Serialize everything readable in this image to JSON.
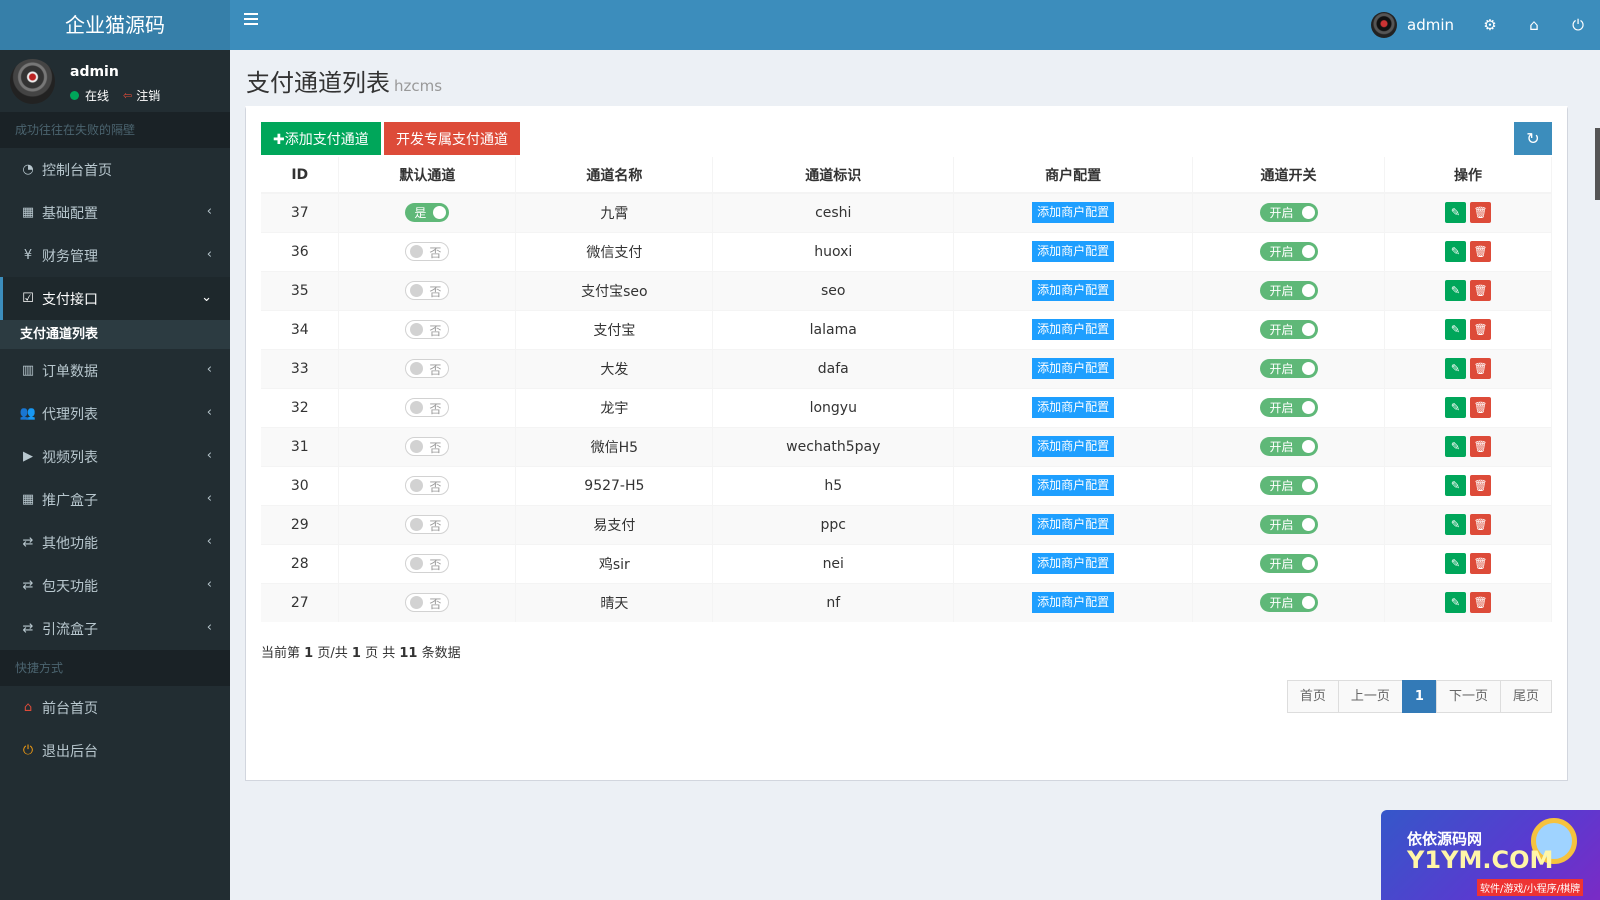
{
  "brand": {
    "title": "企业猫源码"
  },
  "header": {
    "username": "admin"
  },
  "sidebar": {
    "user": {
      "name": "admin",
      "online": "在线",
      "logout": "注销"
    },
    "motto": "成功往往在失败的隔壁",
    "items": [
      {
        "label": "控制台首页",
        "icon": "dashboard-icon",
        "glyph": "◔"
      },
      {
        "label": "基础配置",
        "icon": "grid-icon",
        "glyph": "▦"
      },
      {
        "label": "财务管理",
        "icon": "yen-icon",
        "glyph": "¥"
      },
      {
        "label": "支付接口",
        "icon": "checkbox-icon",
        "glyph": "☑"
      },
      {
        "label": "订单数据",
        "icon": "bar-chart-icon",
        "glyph": "▥"
      },
      {
        "label": "代理列表",
        "icon": "users-icon",
        "glyph": "👥"
      },
      {
        "label": "视频列表",
        "icon": "video-icon",
        "glyph": "▶"
      },
      {
        "label": "推广盒子",
        "icon": "table-icon",
        "glyph": "▦"
      },
      {
        "label": "其他功能",
        "icon": "retweet-icon",
        "glyph": "⇄"
      },
      {
        "label": "包天功能",
        "icon": "retweet-icon",
        "glyph": "⇄"
      },
      {
        "label": "引流盒子",
        "icon": "retweet-icon",
        "glyph": "⇄"
      }
    ],
    "active_sub": "支付通道列表",
    "shortcuts_header": "快捷方式",
    "shortcuts": [
      {
        "label": "前台首页",
        "icon": "home-icon",
        "glyph": "⌂",
        "color": "#dd4b39"
      },
      {
        "label": "退出后台",
        "icon": "power-icon",
        "glyph": "⏻",
        "color": "#f39c12"
      }
    ]
  },
  "page": {
    "title": "支付通道列表",
    "subtitle": "hzcms"
  },
  "toolbar": {
    "add_label": "✚添加支付通道",
    "dev_label": "开发专属支付通道"
  },
  "table": {
    "columns": [
      "ID",
      "默认通道",
      "通道名称",
      "通道标识",
      "商户配置",
      "通道开关",
      "操作"
    ],
    "default_yes": "是",
    "default_no": "否",
    "merchant_btn": "添加商户配置",
    "switch_on": "开启",
    "rows": [
      {
        "id": "37",
        "default": true,
        "name": "九霄",
        "code": "ceshi"
      },
      {
        "id": "36",
        "default": false,
        "name": "微信支付",
        "code": "huoxi"
      },
      {
        "id": "35",
        "default": false,
        "name": "支付宝seo",
        "code": "seo"
      },
      {
        "id": "34",
        "default": false,
        "name": "支付宝",
        "code": "lalama"
      },
      {
        "id": "33",
        "default": false,
        "name": "大发",
        "code": "dafa"
      },
      {
        "id": "32",
        "default": false,
        "name": "龙宇",
        "code": "longyu"
      },
      {
        "id": "31",
        "default": false,
        "name": "微信H5",
        "code": "wechath5pay"
      },
      {
        "id": "30",
        "default": false,
        "name": "9527-H5",
        "code": "h5"
      },
      {
        "id": "29",
        "default": false,
        "name": "易支付",
        "code": "ppc"
      },
      {
        "id": "28",
        "default": false,
        "name": "鸡sir",
        "code": "nei"
      },
      {
        "id": "27",
        "default": false,
        "name": "晴天",
        "code": "nf"
      }
    ]
  },
  "pagination": {
    "info_prefix": "当前第",
    "current_page": "1",
    "info_mid1": "页/共",
    "total_pages": "1",
    "info_mid2": "页 共",
    "total_records": "11",
    "info_suffix": "条数据",
    "buttons": [
      "首页",
      "上一页",
      "1",
      "下一页",
      "尾页"
    ]
  },
  "watermark": {
    "cn": "依依源码网",
    "en": "Y1YM.COM",
    "sub": "软件/游戏/小程序/棋牌"
  }
}
